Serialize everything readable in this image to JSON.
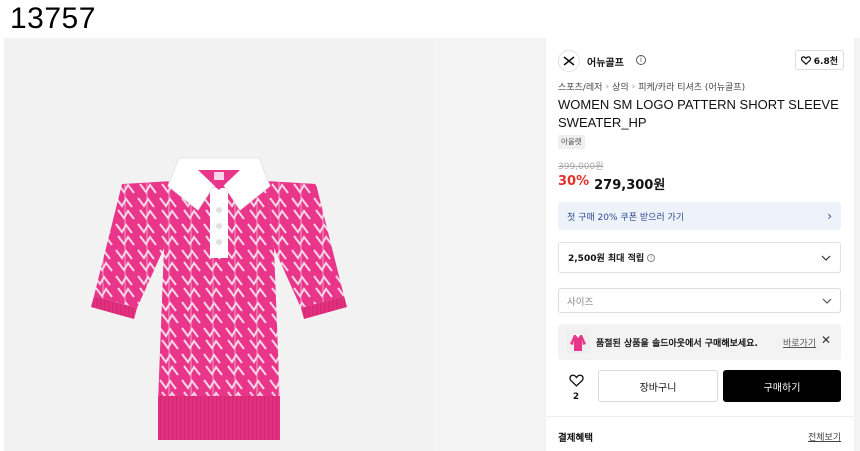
{
  "page_number": "13757",
  "brand": {
    "name": "어뉴골프",
    "logo_icon": "brand-logo-icon"
  },
  "likes": {
    "count": "6.8천",
    "icon": "heart-icon"
  },
  "breadcrumb": [
    "스포츠/레저",
    "상의",
    "피케/카라 티셔츠 (어뉴골프)"
  ],
  "product": {
    "title": "WOMEN SM LOGO PATTERN SHORT SLEEVE SWEATER_HP",
    "badge": "아울렛",
    "original_price": "399,000원",
    "discount": "30%",
    "sale_price": "279,300원",
    "colors": {
      "main": "#e9358a",
      "pattern": "#f6d6e6",
      "collar": "#ffffff"
    }
  },
  "coupon": {
    "text": "첫 구매 20% 쿠폰 받으러 가기",
    "icon": "chevron-right-icon"
  },
  "points": {
    "text": "2,500원 최대 적립",
    "icon": "chevron-down-icon"
  },
  "size_select": {
    "placeholder": "사이즈",
    "icon": "chevron-down-icon"
  },
  "soldout_notice": {
    "text": "품절된 상품을 솔드아웃에서 구매해보세요.",
    "link": "바로가기",
    "close_icon": "close-icon"
  },
  "actions": {
    "wish_count": "2",
    "cart_label": "장바구니",
    "buy_label": "구매하기"
  },
  "benefits": {
    "title": "결제혜택",
    "view_all": "전체보기"
  }
}
